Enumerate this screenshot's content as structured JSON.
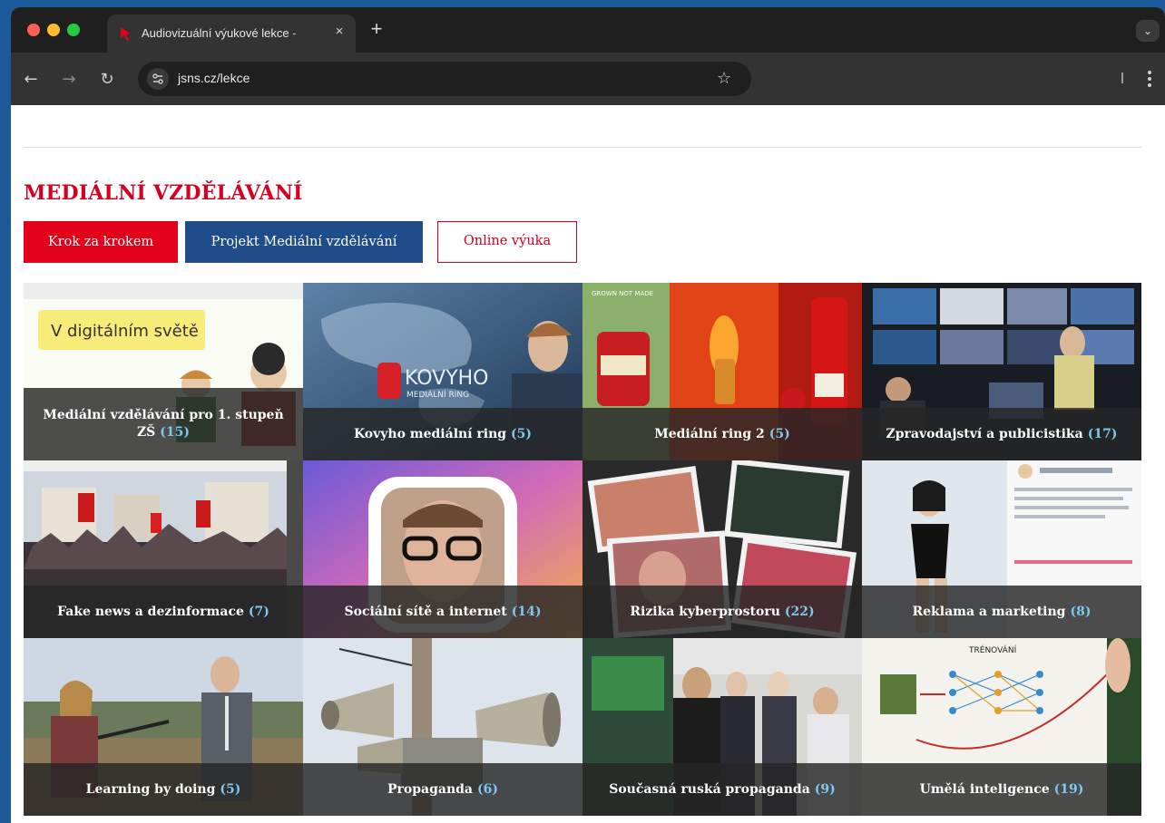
{
  "browser": {
    "tab_title": "Audiovizuální výukové lekce -",
    "tab_close": "×",
    "new_tab": "+",
    "tab_menu": "⌄",
    "url": "jsns.cz/lekce",
    "star": "☆",
    "back": "←",
    "forward": "→",
    "reload": "↻"
  },
  "page": {
    "heading": "MEDIÁLNÍ VZDĚLÁVÁNÍ",
    "buttons": {
      "step": "Krok za krokem",
      "project": "Projekt Mediální vzdělávání",
      "online": "Online výuka"
    }
  },
  "lessons": [
    {
      "title": "Mediální vzdělávání pro 1. stupeň ZŠ",
      "count": "(15)",
      "thumb_text": "V digitálním světě"
    },
    {
      "title": "Kovyho mediální ring",
      "count": "(5)",
      "thumb_text": "KOVYHO",
      "thumb_sub": "MEDIÁLNÍ RING"
    },
    {
      "title": "Mediální ring 2",
      "count": "(5)",
      "thumb_text": "GROWN NOT MADE"
    },
    {
      "title": "Zpravodajství a publicistika",
      "count": "(17)"
    },
    {
      "title": "Fake news a dezinformace",
      "count": "(7)"
    },
    {
      "title": "Sociální sítě a internet",
      "count": "(14)"
    },
    {
      "title": "Rizika kyberprostoru",
      "count": "(22)"
    },
    {
      "title": "Reklama a marketing",
      "count": "(8)"
    },
    {
      "title": "Learning by doing",
      "count": "(5)"
    },
    {
      "title": "Propaganda",
      "count": "(6)"
    },
    {
      "title": "Současná ruská propaganda",
      "count": "(9)"
    },
    {
      "title": "Umělá inteligence",
      "count": "(19)",
      "thumb_text": "TRÉNOVÁNÍ"
    }
  ],
  "colors": {
    "accent_red": "#e2001a",
    "navy": "#1f4d8a",
    "count_blue": "#7ec8f0"
  }
}
